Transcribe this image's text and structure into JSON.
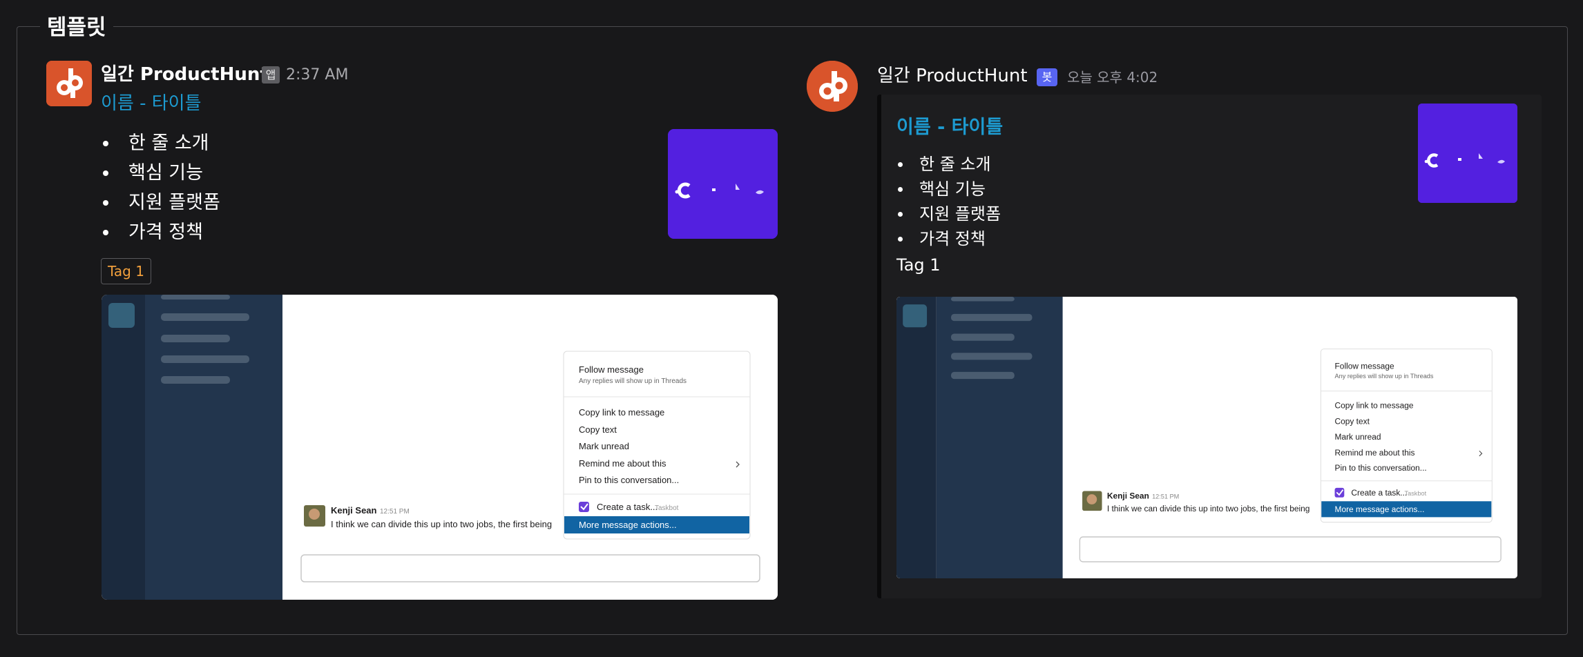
{
  "section": {
    "legend": "템플릿"
  },
  "slack_preview": {
    "bot_name": "일간 ProductHunt",
    "badge": "앱",
    "time": "2:37 AM",
    "title": "이름 - 타이틀",
    "bullets": [
      "한 줄 소개",
      "핵심 기능",
      "지원 플랫폼",
      "가격 정책"
    ],
    "tag": "Tag 1"
  },
  "discord_preview": {
    "bot_name": "일간 ProductHunt",
    "badge": "봇",
    "time": "오늘 오후 4:02",
    "title": "이름 - 타이틀",
    "bullets": [
      "한 줄 소개",
      "핵심 기능",
      "지원 플랫폼",
      "가격 정책"
    ],
    "tag": "Tag 1"
  },
  "screenshot_image": {
    "menu_items": {
      "follow": "Follow message",
      "follow_sub": "Any replies will show up in Threads",
      "copy_link": "Copy link to message",
      "copy_text": "Copy text",
      "mark_unread": "Mark unread",
      "remind": "Remind me about this",
      "pin": "Pin to this conversation...",
      "create_task": "Create a task...",
      "taskbot": "Taskbot",
      "more_actions": "More message actions..."
    },
    "message": {
      "author": "Kenji Sean",
      "time": "12:51 PM",
      "text": "I think we can divide this up into two jobs, the first being"
    }
  },
  "colors": {
    "background": "#18181a",
    "title_link": "#1d9bd1",
    "tag_text": "#f2a03c",
    "avatar_bg": "#d9542b",
    "thumb_bg": "#5320e0",
    "discord_badge": "#5865f2"
  },
  "icons": [
    "producthunt-dp-logo",
    "thumbnail-logo",
    "chevron-right-icon",
    "taskbot-check-icon"
  ]
}
